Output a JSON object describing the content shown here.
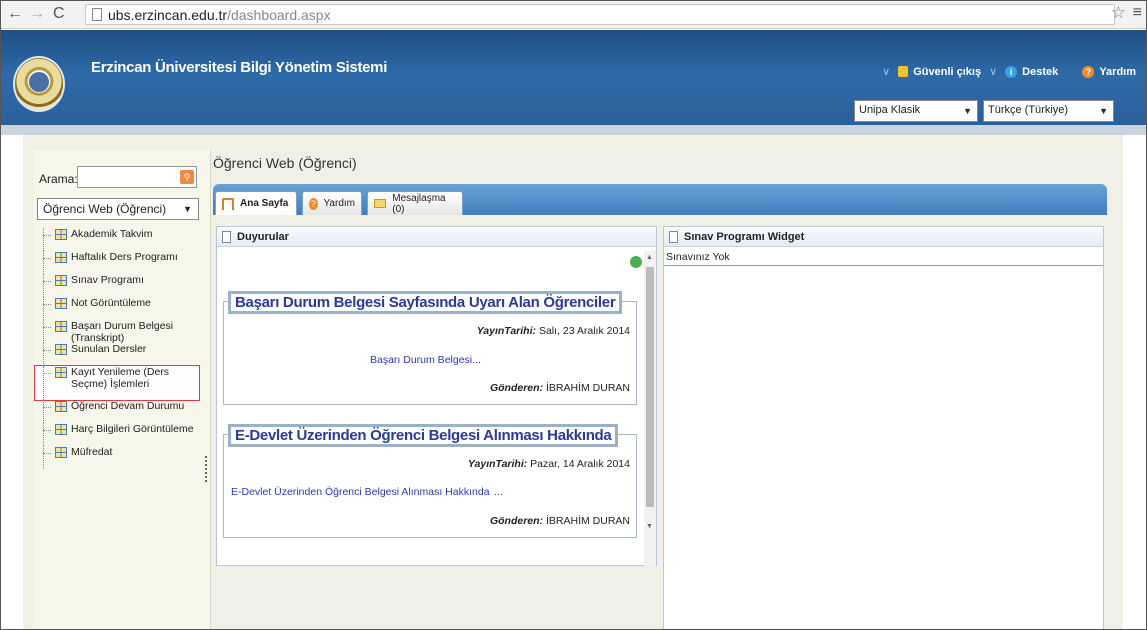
{
  "browser": {
    "url_host": "ubs.erzincan.edu.tr",
    "url_path": "/dashboard.aspx"
  },
  "header": {
    "title": "Erzincan Üniversitesi Bilgi Yönetim Sistemi",
    "links": [
      "Güvenli çıkış",
      "Destek",
      "Yardım"
    ],
    "theme_select": "Unipa Klasik",
    "language_select": "Türkçe (Türkiye)"
  },
  "sidebar": {
    "search_label": "Arama:",
    "module_select": "Öğrenci Web (Öğrenci)",
    "items": [
      "Akademik Takvim",
      "Haftalık Ders Programı",
      "Sınav Programı",
      "Not Görüntüleme",
      "Başarı Durum Belgesi (Transkript)",
      "Sunulan Dersler",
      "Kayıt Yenileme (Ders Seçme) İşlemleri",
      "Öğrenci Devam Durumu",
      "Harç Bilgileri Görüntüleme",
      "Müfredat"
    ]
  },
  "main": {
    "page_title": "Öğrenci Web (Öğrenci)",
    "tabs": [
      "Ana Sayfa",
      "Yardım",
      "Mesajlaşma (0)"
    ],
    "announcements_title": "Duyurular",
    "widget_title": "Sınav Programı Widget",
    "widget_text": "Sınavınız Yok",
    "announcements": [
      {
        "title": "Başarı Durum Belgesi Sayfasında Uyarı Alan Öğrenciler",
        "date_label": "YayınTarihi:",
        "date": "Salı, 23 Aralık 2014",
        "link": "Başarı Durum Belgesi...",
        "sender_label": "Gönderen:",
        "sender": "İBRAHİM DURAN"
      },
      {
        "title": "E-Devlet Üzerinden Öğrenci Belgesi Alınması Hakkında",
        "date_label": "YayınTarihi:",
        "date": "Pazar, 14 Aralık 2014",
        "link": "E-Devlet Üzerinden Öğrenci Belgesi Alınması Hakkında",
        "link_more": "...",
        "sender_label": "Gönderen:",
        "sender": "İBRAHİM DURAN"
      }
    ]
  }
}
